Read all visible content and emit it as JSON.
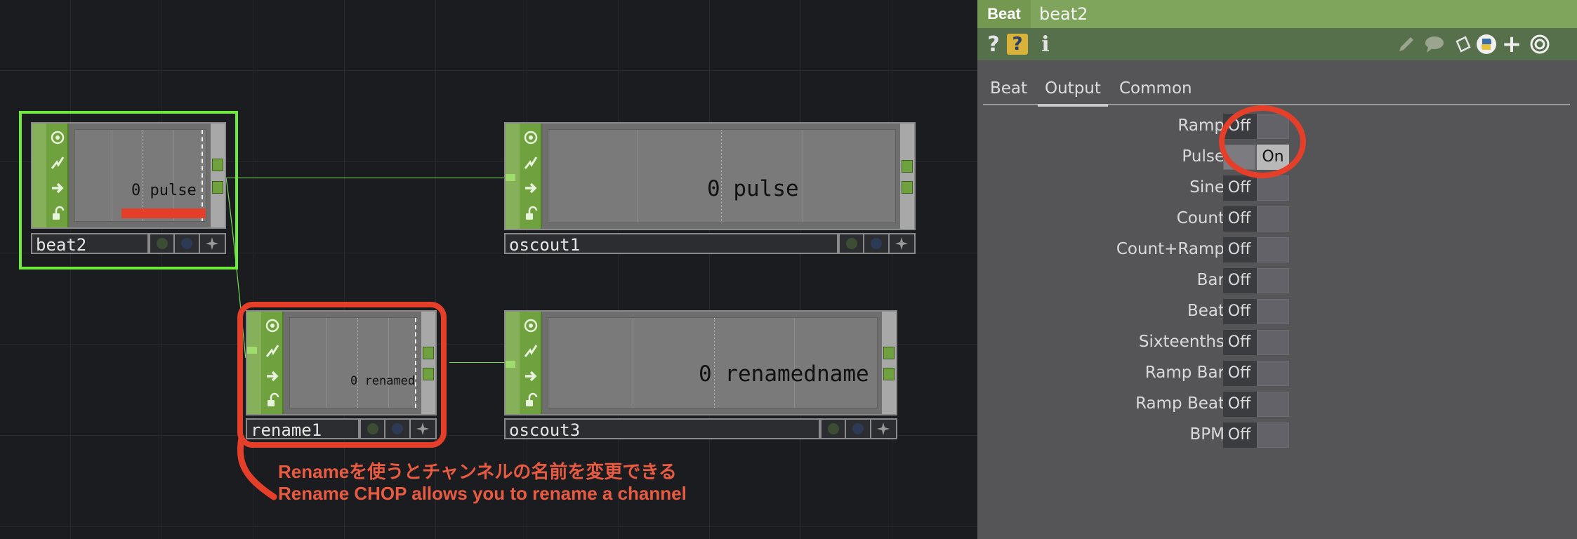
{
  "network": {
    "nodes": [
      {
        "name": "beat2",
        "channel_value": "0",
        "channel_name": "pulse"
      },
      {
        "name": "oscout1",
        "channel_value": "0",
        "channel_name": "pulse"
      },
      {
        "name": "rename1",
        "channel_value": "0",
        "channel_name": "renamedr"
      },
      {
        "name": "oscout3",
        "channel_value": "0",
        "channel_name": "renamedname"
      }
    ],
    "annotation": {
      "line1": "Renameを使うとチャンネルの名前を変更できる",
      "line2": "Rename CHOP allows you to rename a channel",
      "color": "#e53f2a"
    }
  },
  "panel": {
    "op_type": "Beat",
    "op_name": "beat2",
    "toolbar_icons": [
      "help-icon",
      "python-help-icon",
      "info-icon",
      "edit-icon",
      "comment-icon",
      "clipboard-icon",
      "python-icon",
      "add-icon",
      "target-icon"
    ],
    "tabs": [
      "Beat",
      "Output",
      "Common"
    ],
    "active_tab": "Output",
    "params": [
      {
        "label": "Ramp",
        "value": "Off"
      },
      {
        "label": "Pulse",
        "value": "On"
      },
      {
        "label": "Sine",
        "value": "Off"
      },
      {
        "label": "Count",
        "value": "Off"
      },
      {
        "label": "Count+Ramp",
        "value": "Off"
      },
      {
        "label": "Bar",
        "value": "Off"
      },
      {
        "label": "Beat",
        "value": "Off"
      },
      {
        "label": "Sixteenths",
        "value": "Off"
      },
      {
        "label": "Ramp Bar",
        "value": "Off"
      },
      {
        "label": "Ramp Beat",
        "value": "Off"
      },
      {
        "label": "BPM",
        "value": "Off"
      }
    ]
  },
  "colors": {
    "node_green": "#6fa23f",
    "selection": "#6fea3c",
    "annotation_red": "#e53f2a",
    "panel_header": "#7fa45c"
  }
}
